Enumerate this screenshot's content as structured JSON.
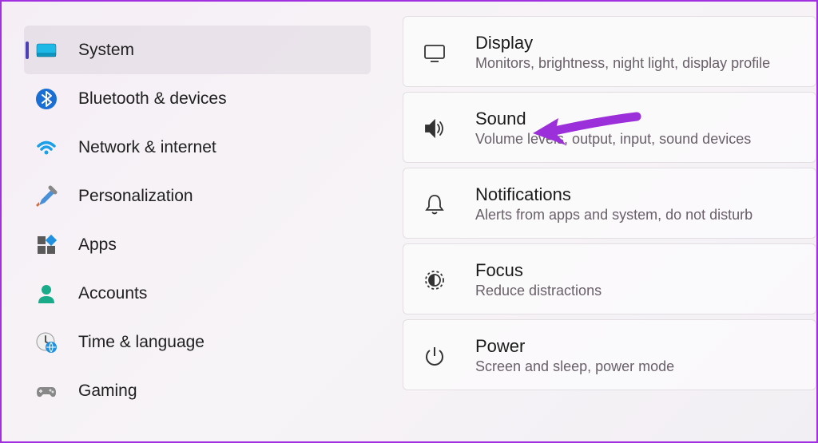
{
  "sidebar": {
    "items": [
      {
        "label": "System"
      },
      {
        "label": "Bluetooth & devices"
      },
      {
        "label": "Network & internet"
      },
      {
        "label": "Personalization"
      },
      {
        "label": "Apps"
      },
      {
        "label": "Accounts"
      },
      {
        "label": "Time & language"
      },
      {
        "label": "Gaming"
      }
    ]
  },
  "cards": [
    {
      "title": "Display",
      "desc": "Monitors, brightness, night light, display profile"
    },
    {
      "title": "Sound",
      "desc": "Volume levels, output, input, sound devices"
    },
    {
      "title": "Notifications",
      "desc": "Alerts from apps and system, do not disturb"
    },
    {
      "title": "Focus",
      "desc": "Reduce distractions"
    },
    {
      "title": "Power",
      "desc": "Screen and sleep, power mode"
    }
  ],
  "annotation": {
    "color": "#9b2fd9"
  }
}
